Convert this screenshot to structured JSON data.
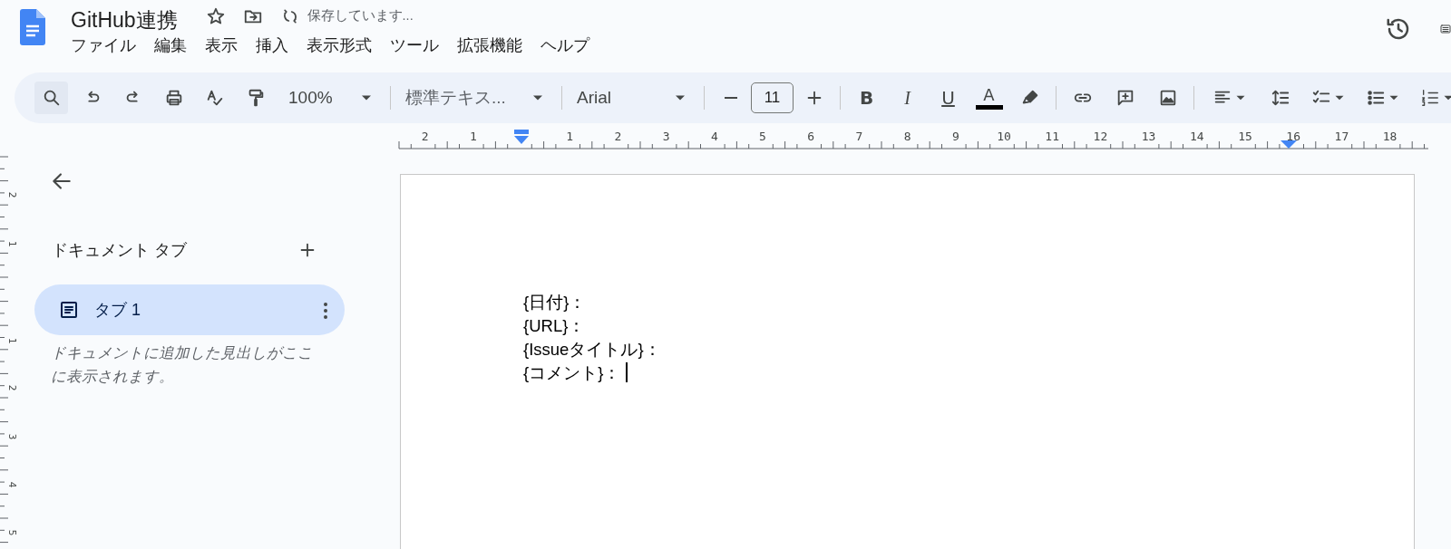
{
  "document": {
    "title": "GitHub連携",
    "status": "保存しています..."
  },
  "menu": [
    "ファイル",
    "編集",
    "表示",
    "挿入",
    "表示形式",
    "ツール",
    "拡張機能",
    "ヘルプ"
  ],
  "toolbar": {
    "zoom": "100%",
    "style": "標準テキス...",
    "font": "Arial",
    "font_size": "11",
    "format": [
      "B",
      "I",
      "U",
      "A"
    ]
  },
  "ruler": {
    "labels": [
      "2",
      "1",
      "1",
      "2",
      "3",
      "4",
      "5",
      "6",
      "7",
      "8",
      "9",
      "10",
      "11",
      "12",
      "13",
      "14",
      "15",
      "16",
      "17",
      "18"
    ]
  },
  "vertical_ruler": {
    "labels": [
      "2",
      "1",
      "1",
      "2",
      "3",
      "4",
      "5"
    ]
  },
  "sidebar": {
    "heading": "ドキュメント タブ",
    "tabs": [
      {
        "label": "タブ 1",
        "selected": true
      }
    ],
    "hint": "ドキュメントに追加した見出しがここに表示されます。"
  },
  "page": {
    "lines": [
      {
        "text": "{日付}：",
        "cursor": false
      },
      {
        "text": "{URL}：",
        "cursor": false
      },
      {
        "text": "{Issueタイトル}：",
        "cursor": false
      },
      {
        "text": "{コメント}：",
        "cursor": true
      }
    ]
  }
}
